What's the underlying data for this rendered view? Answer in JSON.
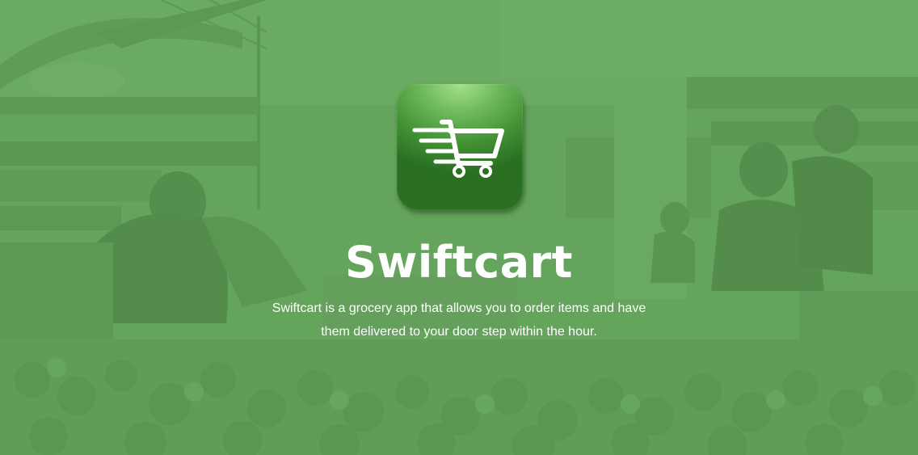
{
  "app": {
    "title": "Swiftcart",
    "description": "Swiftcart is a grocery app that allows you to order items and have them delivered to your door step within the hour.",
    "icon": "shopping-cart-icon"
  },
  "colors": {
    "overlay_green": "#65a45d",
    "icon_green_light": "#a6e08d",
    "icon_green_dark": "#2a6f22",
    "text": "#ffffff"
  }
}
